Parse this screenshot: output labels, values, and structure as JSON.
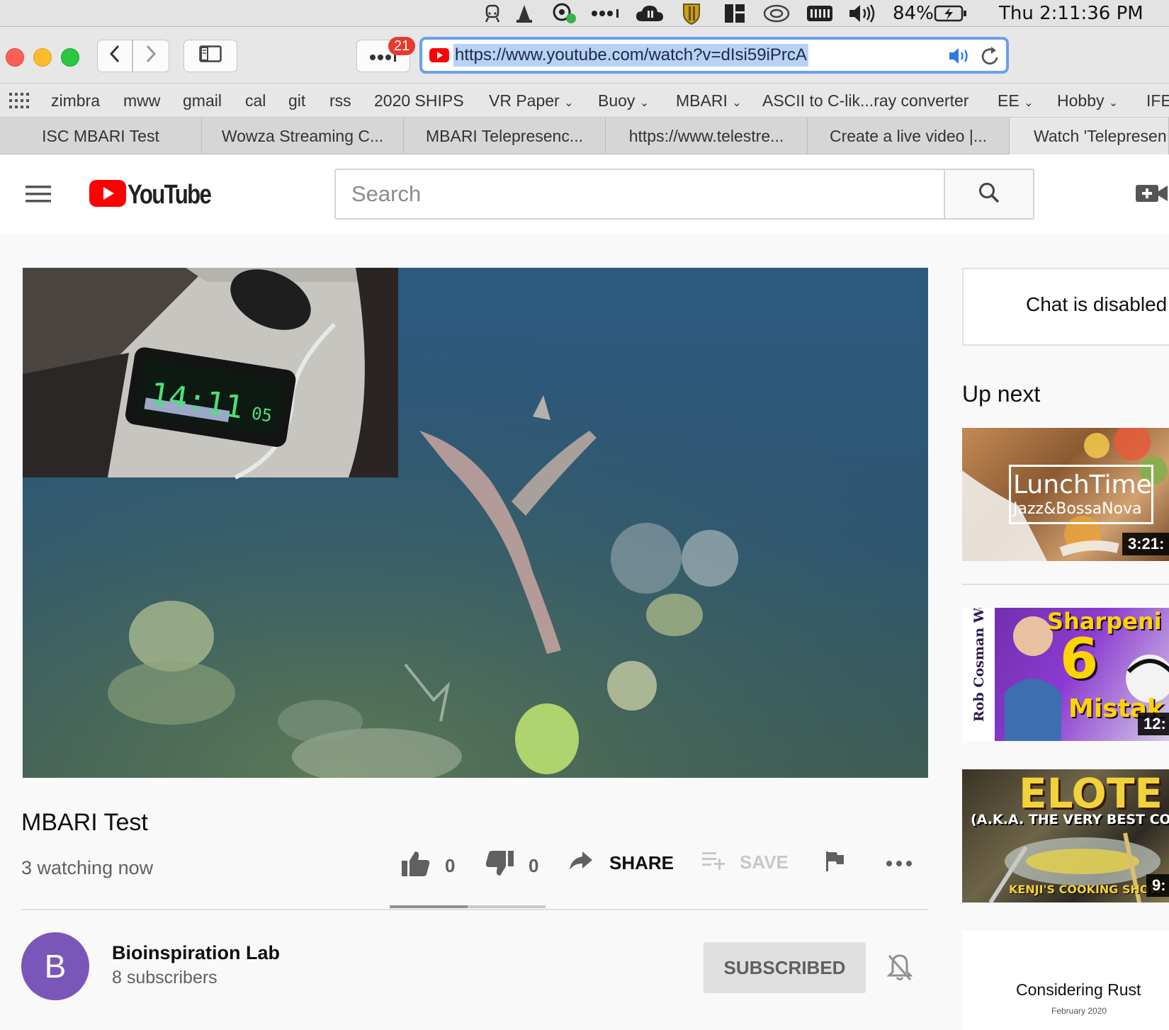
{
  "menubar": {
    "battery": "84%",
    "clock": "Thu 2:11:36 PM"
  },
  "toolbar": {
    "notification_count": "21",
    "url": "https://www.youtube.com/watch?v=dIsi59iPrcA"
  },
  "bookmarks": [
    {
      "label": "zimbra"
    },
    {
      "label": "mww"
    },
    {
      "label": "gmail"
    },
    {
      "label": "cal"
    },
    {
      "label": "git"
    },
    {
      "label": "rss"
    },
    {
      "label": "2020 SHIPS"
    },
    {
      "label": "VR Paper"
    },
    {
      "label": "Buoy"
    },
    {
      "label": "MBARI"
    },
    {
      "label": "ASCII to C-lik...ray converter"
    },
    {
      "label": "EE"
    },
    {
      "label": "Hobby"
    },
    {
      "label": "IFE"
    }
  ],
  "tabs": [
    {
      "label": "ISC MBARI Test"
    },
    {
      "label": "Wowza Streaming C..."
    },
    {
      "label": "MBARI Telepresenc..."
    },
    {
      "label": "https://www.telestre..."
    },
    {
      "label": "Create a live video |..."
    },
    {
      "label": "Watch 'Telepresen"
    }
  ],
  "youtube": {
    "logo_text": "YouTube",
    "search_placeholder": "Search"
  },
  "video": {
    "clock_display": "14:11",
    "clock_seconds": "05",
    "title": "MBARI Test",
    "viewers": "3 watching now",
    "likes": "0",
    "dislikes": "0",
    "like_ratio": 0.5,
    "share_label": "SHARE",
    "save_label": "SAVE"
  },
  "channel": {
    "avatar_letter": "B",
    "name": "Bioinspiration Lab",
    "subscribers": "8 subscribers",
    "subscribe_label": "SUBSCRIBED"
  },
  "sidebar": {
    "chat_message": "Chat is disabled",
    "up_next_label": "Up next",
    "videos": [
      {
        "thumb_title": "LunchTime",
        "thumb_subtitle": "Jazz&BossaNova",
        "duration": "3:21:"
      },
      {
        "thumb_title": "Sharpeni",
        "thumb_number": "6",
        "thumb_word": "Mistak",
        "thumb_side": "Rob Cosman Woodworking",
        "duration": "12:"
      },
      {
        "thumb_title": "ELOTE",
        "thumb_subtitle": "(A.K.A. THE VERY BEST CO",
        "thumb_footer": "KENJI'S COOKING SHOW",
        "duration": "9:"
      }
    ],
    "ad_title": "Considering Rust",
    "ad_date": "February 2020"
  },
  "colors": {
    "youtube_red": "#ff0000",
    "avatar_purple": "#7a56b9",
    "url_highlight": "#b8d2f5",
    "focus_ring": "#6aa0ee"
  }
}
